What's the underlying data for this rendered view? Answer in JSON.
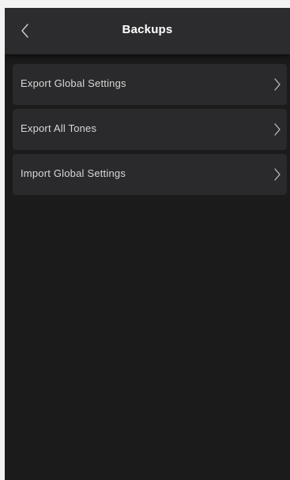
{
  "header": {
    "title": "Backups",
    "back_icon": "chevron-left-icon"
  },
  "backups": {
    "items": [
      {
        "label": "Export Global Settings",
        "icon": "chevron-right-icon"
      },
      {
        "label": "Export All Tones",
        "icon": "chevron-right-icon"
      },
      {
        "label": "Import Global Settings",
        "icon": "chevron-right-icon"
      }
    ]
  },
  "colors": {
    "background": "#1b1b1c",
    "header": "#2c2c2e",
    "row": "#2a2a2c",
    "text": "#d8d8d8",
    "title": "#ffffff"
  }
}
